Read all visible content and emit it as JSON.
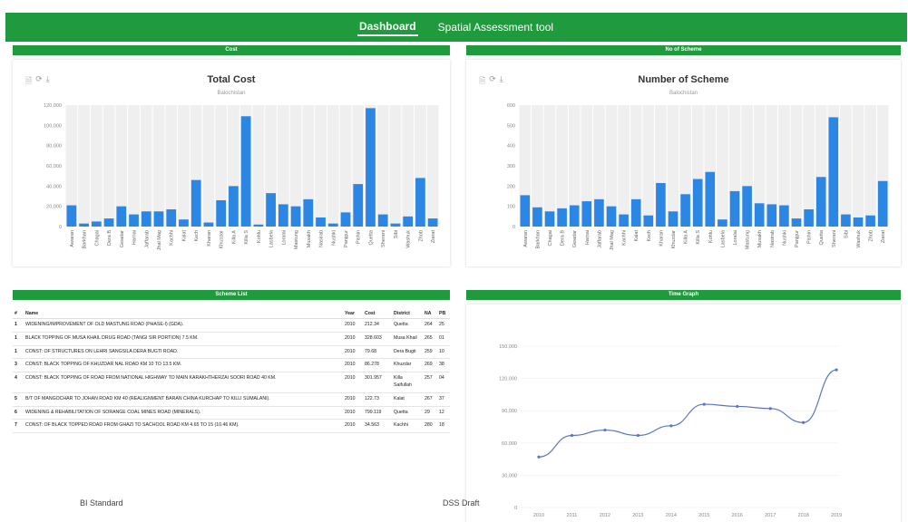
{
  "nav": {
    "tabs": [
      {
        "label": "Dashboard",
        "active": true
      },
      {
        "label": "Spatial Assessment tool",
        "active": false
      }
    ]
  },
  "colors": {
    "green": "#1f9a3c",
    "bar": "#2b87e3",
    "line": "#5b74c9"
  },
  "panels": {
    "cost": "Cost",
    "schemes": "No of Scheme",
    "list": "Scheme List",
    "time": "Time Graph"
  },
  "toolbar_icons": [
    "document-icon",
    "refresh-icon",
    "download-icon"
  ],
  "districts": [
    "Awaran",
    "Barkhan",
    "Chagai",
    "Dera B",
    "Gwadar",
    "Harnai",
    "Jaffarab",
    "Jhal Mag",
    "Kachhi",
    "Kalat",
    "Kech",
    "Kharan",
    "Khuzdar",
    "Killa A",
    "Killa S",
    "Kohlu",
    "Lasbela",
    "Loralai",
    "Mastung",
    "Musakh",
    "Nasirab",
    "Nushki",
    "Panjgur",
    "Pishin",
    "Quetta",
    "Sherani",
    "Sibi",
    "Washuk",
    "Zhob",
    "Ziarat"
  ],
  "footer": {
    "left": "BI Standard",
    "right": "DSS Draft"
  },
  "chart_data": [
    {
      "type": "bar",
      "title": "Total Cost",
      "subtitle": "Balochistan",
      "ylim": [
        0,
        120000
      ],
      "yticks": [
        "0",
        "20,000",
        "40,000",
        "60,000",
        "80,000",
        "100,000",
        "120,000"
      ],
      "categories": [
        "Awaran",
        "Barkhan",
        "Chagai",
        "Dera B",
        "Gwadar",
        "Harnai",
        "Jaffarab",
        "Jhal Mag",
        "Kachhi",
        "Kalat",
        "Kech",
        "Kharan",
        "Khuzdar",
        "Killa A",
        "Killa S",
        "Kohlu",
        "Lasbela",
        "Loralai",
        "Mastung",
        "Musakh",
        "Nasirab",
        "Nushki",
        "Panjgur",
        "Pishin",
        "Quetta",
        "Sherani",
        "Sibi",
        "Washuk",
        "Zhob",
        "Ziarat"
      ],
      "values": [
        21000,
        3000,
        5000,
        8000,
        20000,
        12000,
        15000,
        15000,
        17000,
        7000,
        46000,
        4000,
        26000,
        40000,
        109000,
        2000,
        33000,
        22000,
        20000,
        27000,
        9000,
        3000,
        14000,
        42000,
        117000,
        12000,
        3000,
        10000,
        48000,
        8000
      ]
    },
    {
      "type": "bar",
      "title": "Number of Scheme",
      "subtitle": "Balochistan",
      "ylim": [
        0,
        600
      ],
      "yticks": [
        "0",
        "100",
        "200",
        "300",
        "400",
        "500",
        "600"
      ],
      "categories": [
        "Awaran",
        "Barkhan",
        "Chagai",
        "Dera B",
        "Gwadar",
        "Harnai",
        "Jaffarab",
        "Jhal Mag",
        "Kachhi",
        "Kalat",
        "Kech",
        "Kharan",
        "Khuzdar",
        "Killa A",
        "Killa S",
        "Kohlu",
        "Lasbela",
        "Loralai",
        "Mastung",
        "Musakh",
        "Nasirab",
        "Nushki",
        "Panjgur",
        "Pishin",
        "Quetta",
        "Sherani",
        "Sibi",
        "Washuk",
        "Zhob",
        "Ziarat"
      ],
      "values": [
        155,
        95,
        75,
        90,
        105,
        125,
        135,
        100,
        60,
        135,
        55,
        215,
        75,
        160,
        235,
        270,
        35,
        175,
        200,
        115,
        110,
        105,
        40,
        85,
        245,
        540,
        60,
        45,
        55,
        225,
        65
      ]
    },
    {
      "type": "line",
      "x": [
        "2010",
        "2011",
        "2012",
        "2013",
        "2014",
        "2015",
        "2016",
        "2017",
        "2018",
        "2019"
      ],
      "values": [
        47000,
        67000,
        72000,
        67000,
        76000,
        96000,
        94000,
        92000,
        79000,
        128000
      ],
      "ylim": [
        0,
        150000
      ],
      "yticks": [
        "0",
        "30,000",
        "60,000",
        "90,000",
        "120,000",
        "150,000"
      ]
    }
  ],
  "scheme_list": {
    "headers": [
      "#",
      "Name",
      "Year",
      "Cost",
      "District",
      "NA",
      "PB"
    ],
    "rows": [
      [
        "1",
        "WIDENING/IMPROVEMENT OF OLD MASTUNG ROAD (PHASE-I) (GDA).",
        "2010",
        "212.34",
        "Quetta",
        "264",
        "25"
      ],
      [
        "1",
        "BLACK TOPPING OF MUSA KHAIL DRUG ROAD (TANGI SIR PORTION) 7.5 KM.",
        "2010",
        "328.603",
        "Musa Khail",
        "265",
        "01"
      ],
      [
        "1",
        "CONST: OF STRUCTURES ON LEHRI SANGSILA DERA BUGTI ROAD.",
        "2010",
        "79.68",
        "Dera Bugti",
        "259",
        "10"
      ],
      [
        "3",
        "CONST: BLACK TOPPING OF KHUZDAR NAL ROAD KM 10 TO 13.5 KM.",
        "2010",
        "86.278",
        "Khuzdar",
        "269",
        "38"
      ],
      [
        "4",
        "CONST: BLACK TOPPING OF ROAD FROM NATIONAL HIGHWAY TO MAIN KARAKHTHERZAI SOORI ROAD 40 KM.",
        "2010",
        "301.957",
        "Killa Saifullah",
        "257",
        "04"
      ],
      [
        "5",
        "B/T OF MANGOCHAR TO JOHAN ROAD KM 40 (REALIGNMENT BARAN CHINA KURCHAP TO KILLI SUMALANI).",
        "2010",
        "122.73",
        "Kalat",
        "267",
        "37"
      ],
      [
        "6",
        "WIDENING & REHABILITATION OF SORANGE COAL MINES ROAD (MINERALS).",
        "2010",
        "799.119",
        "Quetta",
        "29",
        "12"
      ],
      [
        "7",
        "CONST: OF BLACK TOPPED ROAD FROM GHAZI TO SACHOOL ROAD KM 4.65 TO 15 (10.46 KM).",
        "2010",
        "34.563",
        "Kachhi",
        "280",
        "18"
      ]
    ]
  }
}
